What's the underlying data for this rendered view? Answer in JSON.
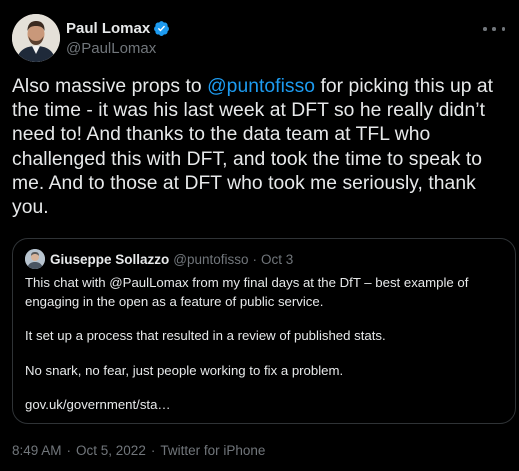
{
  "author": {
    "display_name": "Paul Lomax",
    "handle": "@PaulLomax",
    "verified_icon": "verified-badge-icon",
    "verified_color": "#1d9bf0"
  },
  "tweet": {
    "text_before": "Also massive props to ",
    "mention": "@puntofisso",
    "text_after": " for picking this up at the time - it was his last week at DFT so he really didn’t need to! And thanks to the data team at TFL who challenged this with DFT, and took the time to speak to me. And to those at DFT who took me seriously, thank you."
  },
  "quote": {
    "name": "Giuseppe Sollazzo",
    "handle": "@puntofisso",
    "separator": "·",
    "date": "Oct 3",
    "paragraphs": [
      "This chat with @PaulLomax from my final days at the DfT – best example of engaging in the open as a feature of public service.",
      "It set up a process that resulted in a review of published stats.",
      "No snark, no fear, just people working to fix a problem.",
      "gov.uk/government/sta…"
    ]
  },
  "meta": {
    "time": "8:49 AM",
    "separator": "·",
    "date": "Oct 5, 2022",
    "source": "Twitter for iPhone"
  },
  "colors": {
    "background": "#000000",
    "text": "#e7e9ea",
    "secondary": "#71767b",
    "link": "#1d9bf0",
    "border": "#2f3336"
  }
}
